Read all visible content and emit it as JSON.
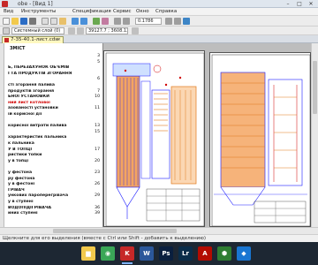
{
  "window": {
    "title": "obe - [Вид 1]",
    "controls": [
      "–",
      "□",
      "✕"
    ]
  },
  "menu": [
    "Вид",
    "Инструменты",
    "Спецификация",
    "Сервис",
    "Окно",
    "Справка"
  ],
  "toolbar": {
    "scale_value": "0.1786",
    "layer_value": "Системный слой (0)",
    "coords_value": "39127.7 ; 3608.13"
  },
  "doc_tab": {
    "label": "7-35-40.1-лист.cdw",
    "close": "×"
  },
  "sheet1": {
    "heading": "ЗМІСТ",
    "toc": [
      {
        "text": "",
        "num": "3",
        "red": false
      },
      {
        "text": "",
        "num": "5",
        "red": false
      },
      {
        "text": "Ь, ПЕРЕЗАХУНОК ОБ'ЄМІВ",
        "num": "",
        "red": false
      },
      {
        "text": "І ТА ПРОДУКТІВ ЗГОРАННЯ",
        "num": "",
        "red": false
      },
      {
        "text": "",
        "num": "6",
        "red": false
      },
      {
        "text": "сті згорання палива",
        "num": "",
        "red": false
      },
      {
        "text": "продуктів згорання",
        "num": "7",
        "red": false
      },
      {
        "text": "ЬНОЇ УСТАНОВКИ",
        "num": "10",
        "red": false
      },
      {
        "text": "ний лист котлової ",
        "num": "",
        "red": true
      },
      {
        "text": "азованості установки",
        "num": "11",
        "red": false
      },
      {
        "text": "ій корисної дії",
        "num": "",
        "red": false
      },
      {
        "text": "",
        "num": "",
        "red": false
      },
      {
        "text": "корисної витрати палива",
        "num": "13",
        "red": false
      },
      {
        "text": "",
        "num": "15",
        "red": false
      },
      {
        "text": "характеристик пальника",
        "num": "",
        "red": false
      },
      {
        "text": "к пальника",
        "num": "",
        "red": false
      },
      {
        "text": "У В ТОПЦІ",
        "num": "17",
        "red": false
      },
      {
        "text": "ристики топки",
        "num": "",
        "red": false
      },
      {
        "text": "у в топці",
        "num": "20",
        "red": false
      },
      {
        "text": "",
        "num": "",
        "red": false
      },
      {
        "text": "у фестона",
        "num": "23",
        "red": false
      },
      {
        "text": "ру фестона",
        "num": "",
        "red": false
      },
      {
        "text": "у в фестоні",
        "num": "26",
        "red": false
      },
      {
        "text": "ГРІВАЧ",
        "num": "",
        "red": false
      },
      {
        "text": "ункових пароперегрівача",
        "num": "29",
        "red": false
      },
      {
        "text": "у в ступені",
        "num": "",
        "red": false
      },
      {
        "text": "ВОДОПІДІГРІВАЧА",
        "num": "36",
        "red": false
      },
      {
        "text": "иних ступені",
        "num": "39",
        "red": false
      }
    ]
  },
  "statusbar": {
    "text": "Щелкните для его выделения (вместе с Ctrl или Shift - добавить к выделению)"
  },
  "taskbar": [
    {
      "name": "file-explorer",
      "glyph": "▆",
      "color": "#f2c94c"
    },
    {
      "name": "chrome",
      "glyph": "◉",
      "color": "#3aa757"
    },
    {
      "name": "kompas",
      "glyph": "K",
      "color": "#c62828"
    },
    {
      "name": "word",
      "glyph": "W",
      "color": "#2b579a"
    },
    {
      "name": "photoshop",
      "glyph": "Ps",
      "color": "#0a1f3f"
    },
    {
      "name": "lightroom",
      "glyph": "Lr",
      "color": "#0a2d4a"
    },
    {
      "name": "acrobat",
      "glyph": "A",
      "color": "#b30b00"
    },
    {
      "name": "app-green",
      "glyph": "⬢",
      "color": "#2e7d32"
    },
    {
      "name": "app-blue",
      "glyph": "◆",
      "color": "#1976d2"
    }
  ],
  "colors": {
    "drawing_line": "#1a1aff",
    "insulation": "#e07a1f",
    "red_accent": "#d00000",
    "taskbar_bg": "#1d2733"
  }
}
